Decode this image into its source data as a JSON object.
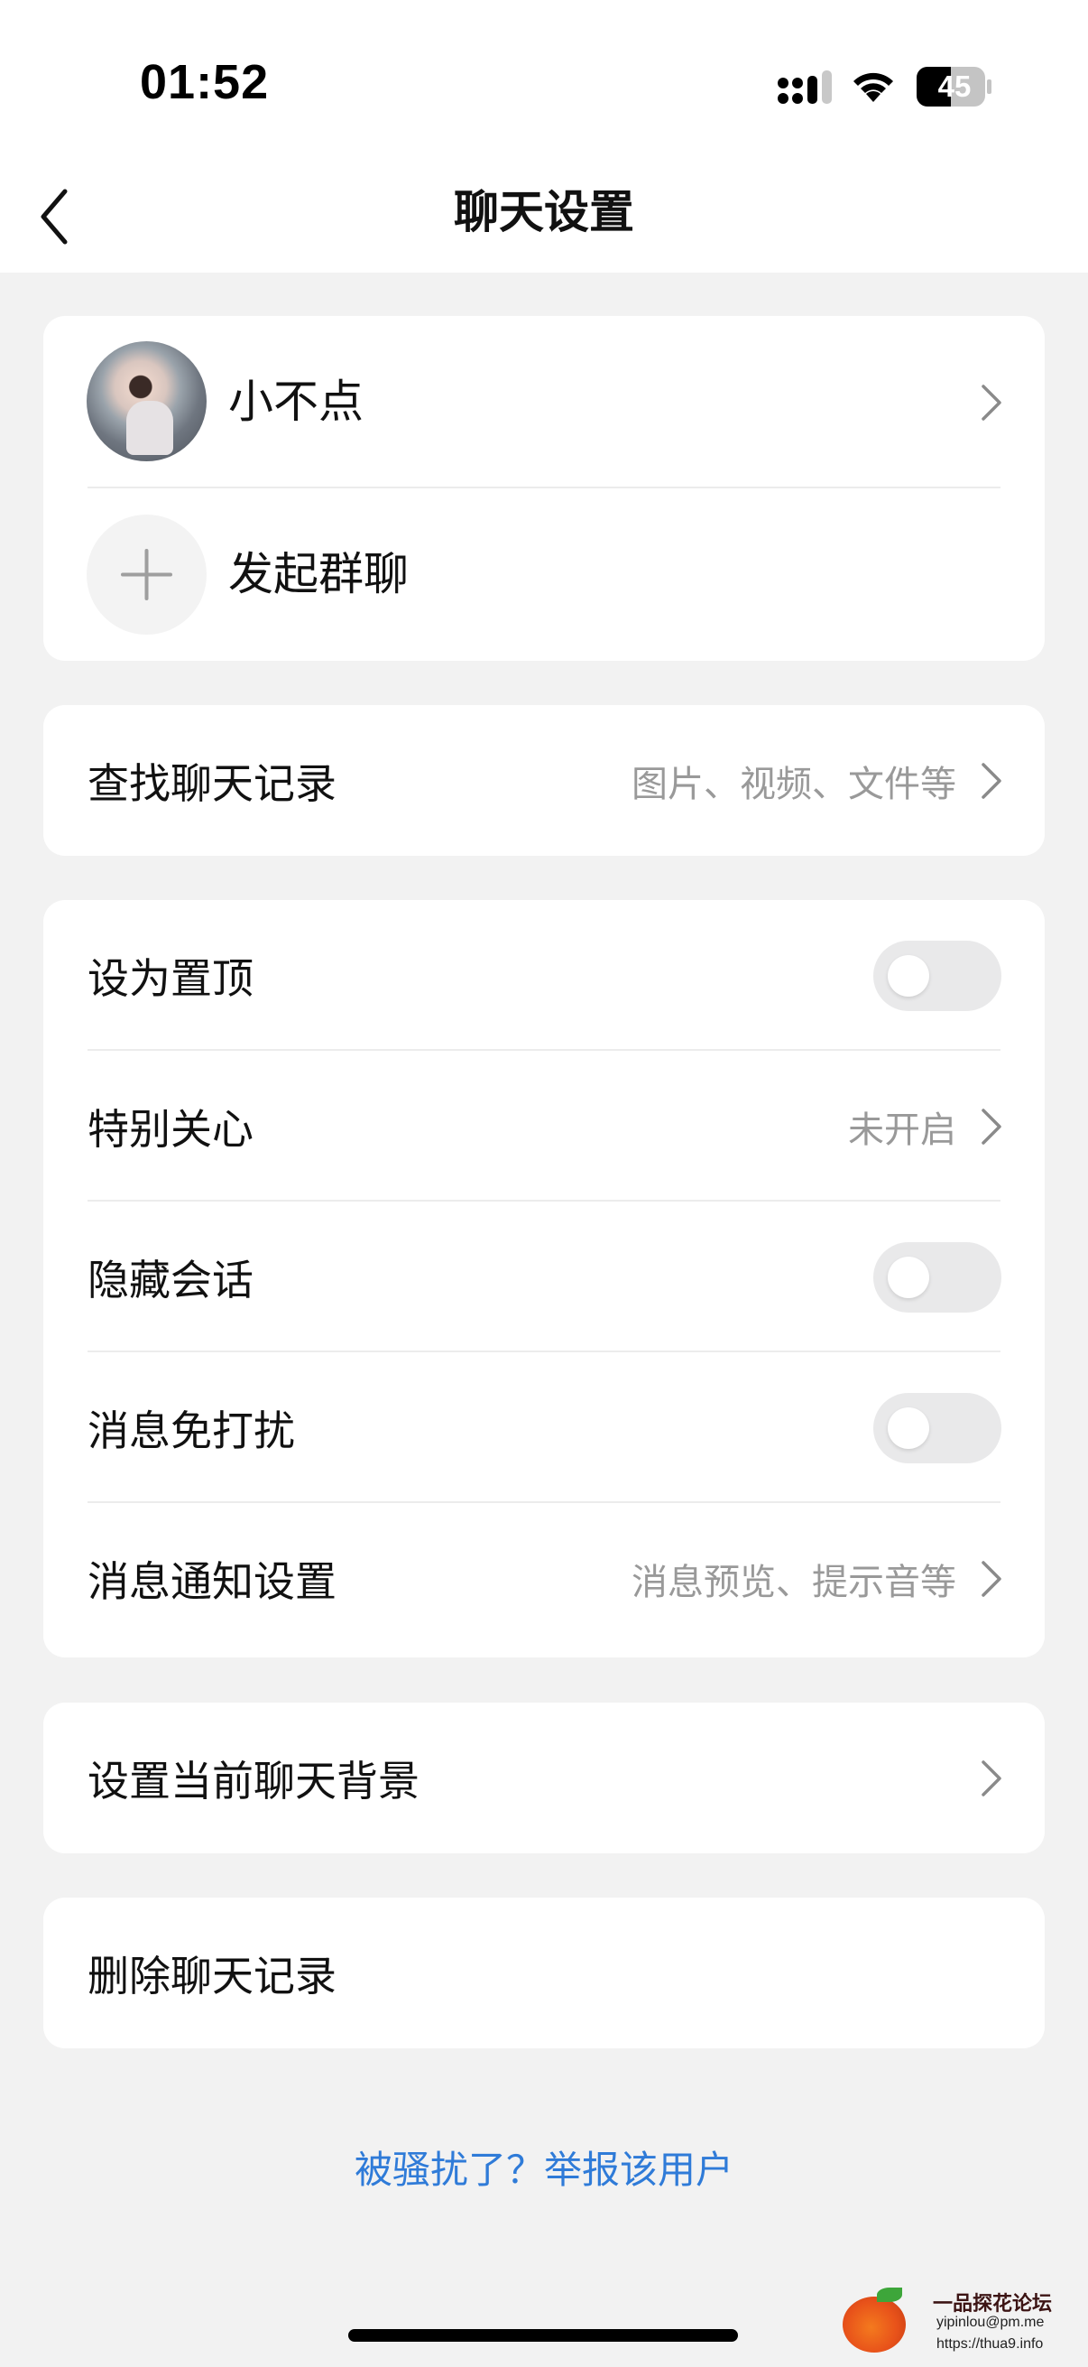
{
  "status_bar": {
    "time": "01:52",
    "battery": "45",
    "icons": [
      "signal-icon",
      "wifi-icon",
      "battery-icon"
    ]
  },
  "nav": {
    "title": "聊天设置",
    "back_icon": "chevron-left-icon"
  },
  "profile": {
    "name": "小不点",
    "add_group_label": "发起群聊"
  },
  "search_history": {
    "label": "查找聊天记录",
    "hint": "图片、视频、文件等"
  },
  "settings": {
    "pin_label": "设为置顶",
    "pin_on": false,
    "special_care_label": "特别关心",
    "special_care_value": "未开启",
    "hide_chat_label": "隐藏会话",
    "hide_chat_on": false,
    "dnd_label": "消息免打扰",
    "dnd_on": false,
    "notify_label": "消息通知设置",
    "notify_hint": "消息预览、提示音等"
  },
  "background": {
    "label": "设置当前聊天背景"
  },
  "delete": {
    "label": "删除聊天记录"
  },
  "report": {
    "label": "被骚扰了？举报该用户"
  },
  "watermark": {
    "title": "一品探花论坛",
    "email": "yipinlou@pm.me",
    "url": "https://thua9.info"
  },
  "colors": {
    "page_bg": "#f2f2f2",
    "card_bg": "#ffffff",
    "link": "#2f7bd8",
    "hint": "#999999",
    "toggle_off": "#e9e9ea"
  }
}
